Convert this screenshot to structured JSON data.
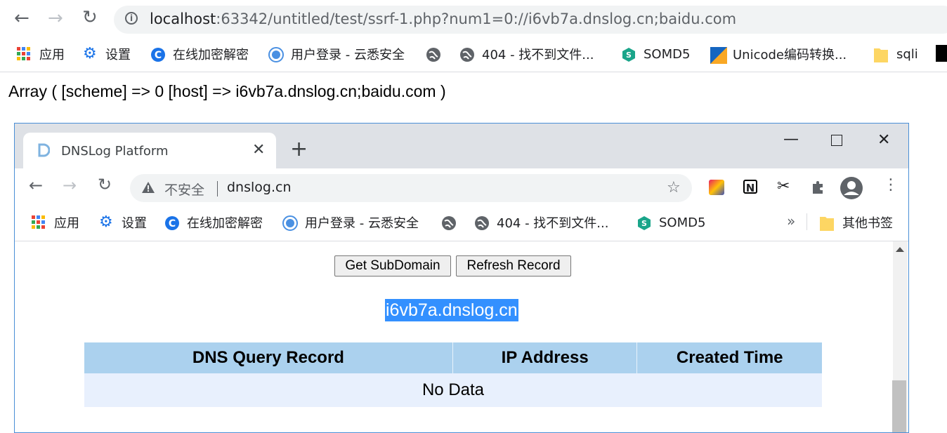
{
  "outer": {
    "url_host": "localhost",
    "url_path": ":63342/untitled/test/ssrf-1.php?num1=0://i6vb7a.dnslog.cn;baidu.com",
    "bookmarks": [
      {
        "label": "应用",
        "icon": "apps-grid-icon"
      },
      {
        "label": "设置",
        "icon": "gear-icon"
      },
      {
        "label": "在线加密解密",
        "icon": "blue-c-icon"
      },
      {
        "label": "用户登录 - 云悉安全",
        "icon": "yunxi-icon"
      },
      {
        "label": "",
        "icon": "globe-icon"
      },
      {
        "label": "404 - 找不到文件...",
        "icon": "globe-icon"
      },
      {
        "label": "SOMD5",
        "icon": "somd5-icon"
      },
      {
        "label": "Unicode编码转换...",
        "icon": "unicode-icon"
      },
      {
        "label": "sqli",
        "icon": "folder-icon"
      }
    ],
    "php_output": "Array ( [scheme] => 0 [host] => i6vb7a.dnslog.cn;baidu.com )"
  },
  "inner": {
    "tab_title": "DNSLog Platform",
    "insecure_label": "不安全",
    "url": "dnslog.cn",
    "bookmarks": [
      {
        "label": "应用",
        "icon": "apps-grid-icon"
      },
      {
        "label": "设置",
        "icon": "gear-icon"
      },
      {
        "label": "在线加密解密",
        "icon": "blue-c-icon"
      },
      {
        "label": "用户登录 - 云悉安全",
        "icon": "yunxi-icon"
      },
      {
        "label": "",
        "icon": "globe-icon"
      },
      {
        "label": "404 - 找不到文件...",
        "icon": "globe-icon"
      },
      {
        "label": "SOMD5",
        "icon": "somd5-icon"
      }
    ],
    "more_bookmarks": "»",
    "other_bookmarks": "其他书签",
    "page": {
      "get_subdomain_button": "Get SubDomain",
      "refresh_record_button": "Refresh Record",
      "subdomain": "i6vb7a.dnslog.cn",
      "table_headers": [
        "DNS Query Record",
        "IP Address",
        "Created Time"
      ],
      "no_data": "No Data"
    }
  },
  "colors": {
    "selection": "#3390ff",
    "table_header": "#abd1ee",
    "table_row": "#e8f0fd",
    "window_border": "#4a8fd6"
  }
}
